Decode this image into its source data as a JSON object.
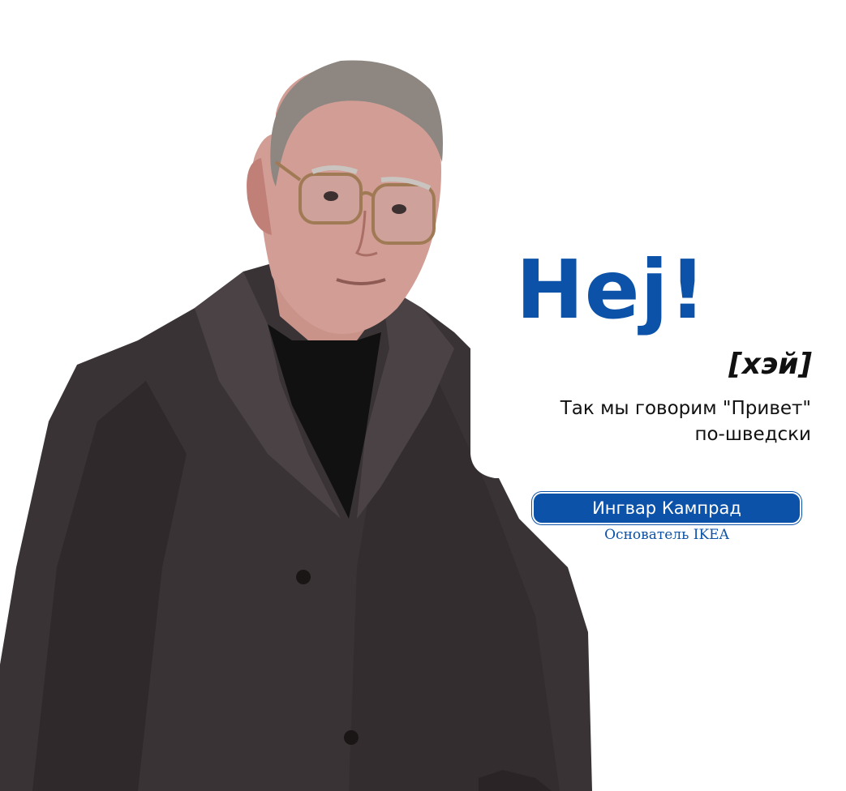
{
  "greeting": "Hej!",
  "pronunciation": "[хэй]",
  "caption": {
    "line1": "Так мы говорим \"Привет\"",
    "line2": "по-шведски"
  },
  "person": {
    "name": "Ингвар Кампрад",
    "role": "Основатель IKEA"
  },
  "colors": {
    "brand_blue": "#0b52a8",
    "coat": "#3a3335",
    "background": "#ffffff"
  }
}
